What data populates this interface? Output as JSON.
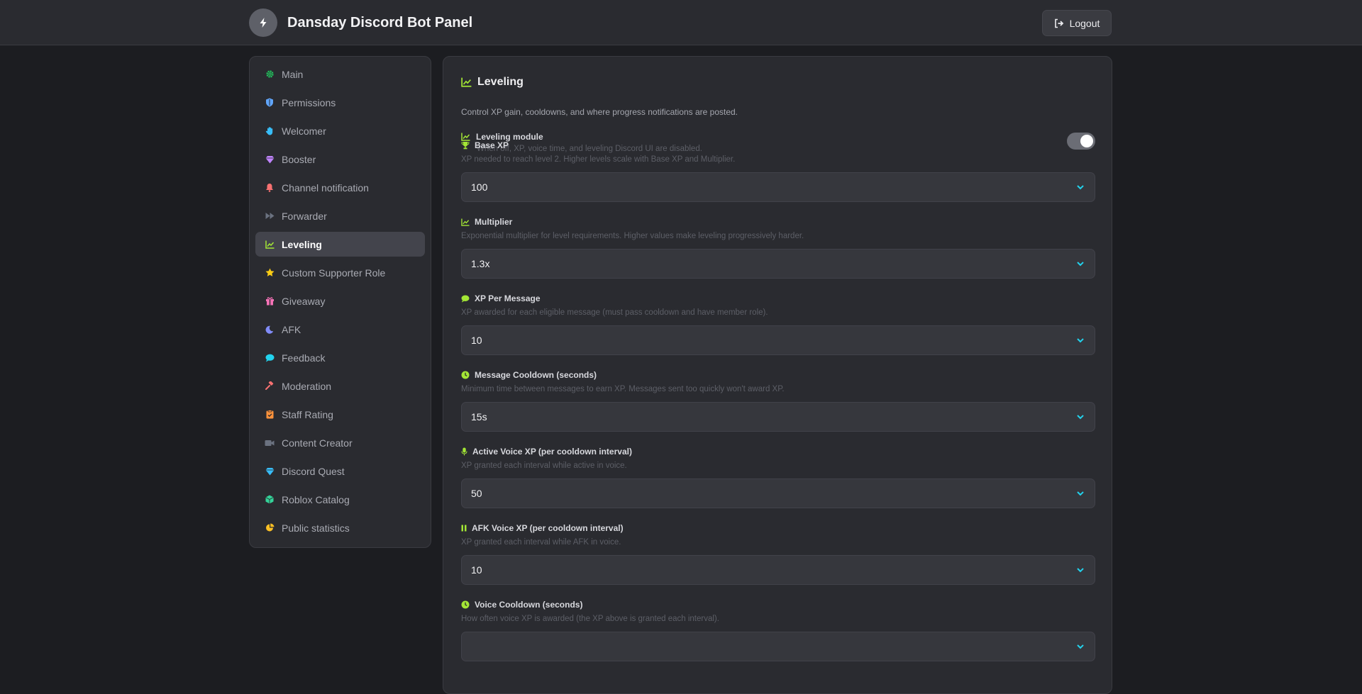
{
  "header": {
    "title": "Dansday Discord Bot Panel",
    "logout_label": "Logout"
  },
  "sidebar": {
    "items": [
      {
        "label": "Main",
        "icon": "gear-icon",
        "color": "#22c55e"
      },
      {
        "label": "Permissions",
        "icon": "shield-icon",
        "color": "#60a5fa"
      },
      {
        "label": "Welcomer",
        "icon": "hand-icon",
        "color": "#38bdf8"
      },
      {
        "label": "Booster",
        "icon": "gem-icon",
        "color": "#c084fc"
      },
      {
        "label": "Channel notification",
        "icon": "bell-icon",
        "color": "#f87171"
      },
      {
        "label": "Forwarder",
        "icon": "forward-icon",
        "color": "#6b7280"
      },
      {
        "label": "Leveling",
        "icon": "chart-line-icon",
        "color": "#a3e635",
        "active": true
      },
      {
        "label": "Custom Supporter Role",
        "icon": "star-icon",
        "color": "#facc15"
      },
      {
        "label": "Giveaway",
        "icon": "gift-icon",
        "color": "#f472b6"
      },
      {
        "label": "AFK",
        "icon": "moon-icon",
        "color": "#818cf8"
      },
      {
        "label": "Feedback",
        "icon": "comment-icon",
        "color": "#22d3ee"
      },
      {
        "label": "Moderation",
        "icon": "gavel-icon",
        "color": "#f87171"
      },
      {
        "label": "Staff Rating",
        "icon": "clipboard-icon",
        "color": "#fb923c"
      },
      {
        "label": "Content Creator",
        "icon": "video-icon",
        "color": "#6b7280"
      },
      {
        "label": "Discord Quest",
        "icon": "gem-icon",
        "color": "#38bdf8"
      },
      {
        "label": "Roblox Catalog",
        "icon": "cube-icon",
        "color": "#34d399"
      },
      {
        "label": "Public statistics",
        "icon": "pie-chart-icon",
        "color": "#fbbf24"
      }
    ]
  },
  "panel": {
    "title": "Leveling",
    "description": "Control XP gain, cooldowns, and where progress notifications are posted.",
    "accent": "#a3e635",
    "module": {
      "label": "Leveling module",
      "sub": "When off, XP, voice time, and leveling Discord UI are disabled.",
      "enabled": true
    },
    "fields": [
      {
        "label": "Base XP",
        "icon": "trophy-icon",
        "help": "XP needed to reach level 2. Higher levels scale with Base XP and Multiplier.",
        "value": "100"
      },
      {
        "label": "Multiplier",
        "icon": "chart-line-icon",
        "help": "Exponential multiplier for level requirements. Higher values make leveling progressively harder.",
        "value": "1.3x"
      },
      {
        "label": "XP Per Message",
        "icon": "comment-icon",
        "help": "XP awarded for each eligible message (must pass cooldown and have member role).",
        "value": "10"
      },
      {
        "label": "Message Cooldown (seconds)",
        "icon": "clock-icon",
        "help": "Minimum time between messages to earn XP. Messages sent too quickly won't award XP.",
        "value": "15s"
      },
      {
        "label": "Active Voice XP (per cooldown interval)",
        "icon": "microphone-icon",
        "help": "XP granted each interval while active in voice.",
        "value": "50"
      },
      {
        "label": "AFK Voice XP (per cooldown interval)",
        "icon": "pause-icon",
        "help": "XP granted each interval while AFK in voice.",
        "value": "10"
      },
      {
        "label": "Voice Cooldown (seconds)",
        "icon": "clock-icon",
        "help": "How often voice XP is awarded (the XP above is granted each interval).",
        "value": ""
      }
    ]
  }
}
